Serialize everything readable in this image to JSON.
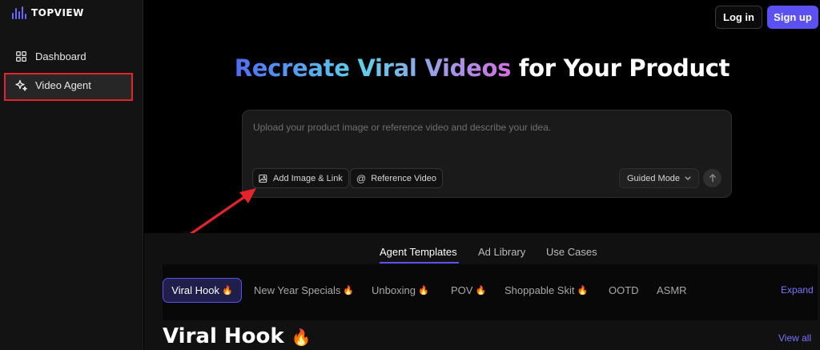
{
  "brand": {
    "name": "TOPVIEW"
  },
  "sidebar": {
    "items": [
      {
        "label": "Dashboard",
        "icon": "grid-icon"
      },
      {
        "label": "Video Agent",
        "icon": "sparkle-icon"
      }
    ]
  },
  "header": {
    "login_label": "Log in",
    "signup_label": "Sign up"
  },
  "hero": {
    "title_gradient": "Recreate Viral Videos",
    "title_rest": " for Your Product"
  },
  "prompt": {
    "placeholder": "Upload your product image or reference video and describe your idea.",
    "add_image_label": "Add Image & Link",
    "reference_video_label": "Reference Video",
    "mode_label": "Guided Mode"
  },
  "tabs": [
    "Agent Templates",
    "Ad Library",
    "Use Cases"
  ],
  "categories": [
    "Viral Hook",
    "New Year Specials",
    "Unboxing",
    "POV",
    "Shoppable Skit",
    "OOTD",
    "ASMR"
  ],
  "expand_label": "Expand",
  "section": {
    "title": "Viral Hook",
    "view_all_label": "View all"
  },
  "colors": {
    "accent": "#5b50f0",
    "annotation": "#e5232a"
  }
}
